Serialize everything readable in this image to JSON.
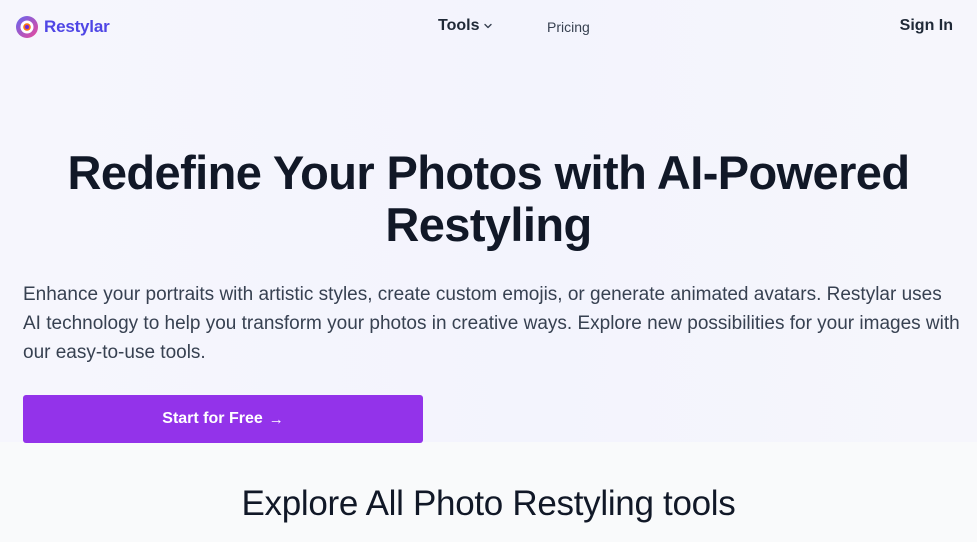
{
  "nav": {
    "brand": "Restylar",
    "tools_label": "Tools",
    "pricing_label": "Pricing",
    "signin_label": "Sign In"
  },
  "hero": {
    "title_line1": "Redefine Your Photos with AI-Powered",
    "title_line2": "Restyling",
    "description": "Enhance your portraits with artistic styles, create custom emojis, or generate animated avatars. Restylar uses AI technology to help you transform your photos in creative ways. Explore new possibilities for your images with our easy-to-use tools.",
    "cta_label": "Start for Free",
    "cta_arrow": "→"
  },
  "section": {
    "title": "Explore All Photo Restyling tools"
  },
  "icons": {
    "logo": "restylar-logo-icon",
    "tools_chevron": "chevron-down-icon",
    "cta_arrow": "arrow-right-icon"
  },
  "colors": {
    "brand": "#4f46e5",
    "cta": "#9333ea",
    "text": "#111827"
  }
}
